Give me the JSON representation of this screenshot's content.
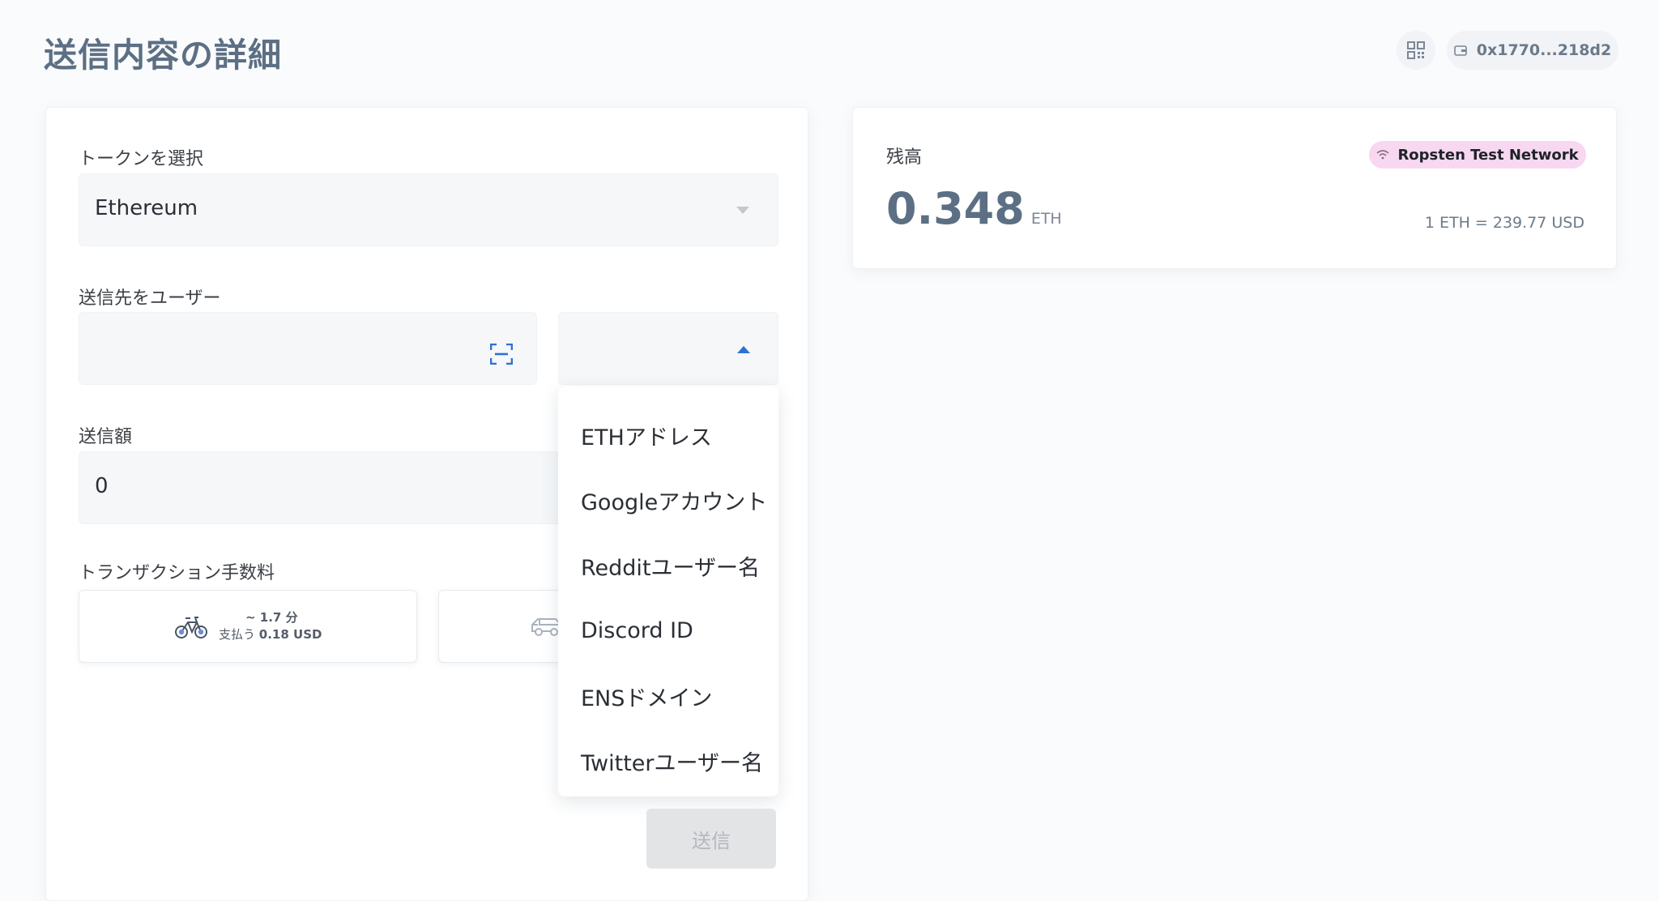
{
  "header": {
    "title": "送信内容の詳細",
    "wallet_address": "0x1770...218d2"
  },
  "form": {
    "token_label": "トークンを選択",
    "token_value": "Ethereum",
    "recipient_label": "送信先をユーザー",
    "recipient_value": "",
    "recipient_type_value": "",
    "amount_label": "送信額",
    "amount_value": "0",
    "fee_label": "トランザクション手数料",
    "fee_options": [
      {
        "time": "~ 1.7 分",
        "pay_prefix": "支払う",
        "pay_amount": "0.18 USD",
        "icon": "bicycle-icon"
      },
      {
        "icon": "car-icon"
      }
    ],
    "send_label": "送信"
  },
  "recipient_type_menu": {
    "items": [
      "ETHアドレス",
      "Googleアカウント",
      "Redditユーザー名",
      "Discord ID",
      "ENSドメイン",
      "Twitterユーザー名"
    ]
  },
  "balance": {
    "label": "残高",
    "network": "Ropsten Test Network",
    "amount": "0.348",
    "unit": "ETH",
    "rate": "1 ETH = 239.77 USD"
  },
  "colors": {
    "accent": "#2f6fd6",
    "network_badge_bg": "#f8d7f1",
    "title": "#5c6f84"
  }
}
